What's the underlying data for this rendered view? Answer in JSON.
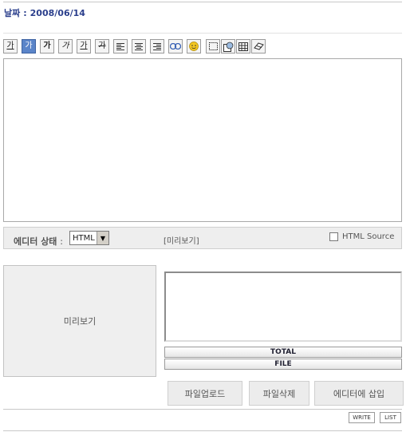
{
  "date": {
    "label": "날짜",
    "colon": ":",
    "value": "2008/06/14"
  },
  "toolbar": {
    "font_size_glyph": "가",
    "font_style_glyph": "가",
    "bold_glyph": "가",
    "italic_glyph": "가",
    "underline_glyph": "가",
    "strike_glyph": "가",
    "selected_tool": "font-style"
  },
  "status_bar": {
    "label": "에디터 상태",
    "colon": ":",
    "mode_value": "HTML",
    "preview_link": "[미리보기]",
    "html_source_label": "HTML Source",
    "html_source_checked": false
  },
  "attachments": {
    "preview_label": "미리보기",
    "total_label": "TOTAL",
    "file_label": "FILE",
    "upload_button": "파일업로드",
    "delete_button": "파일삭제",
    "insert_button": "에디터에 삽입"
  },
  "footer": {
    "write_button": "WRITE",
    "list_button": "LIST"
  },
  "colors": {
    "date_label": "#2b3f8c",
    "selected_tool_bg": "#5b85c9",
    "panel_bg": "#eeeeee"
  }
}
